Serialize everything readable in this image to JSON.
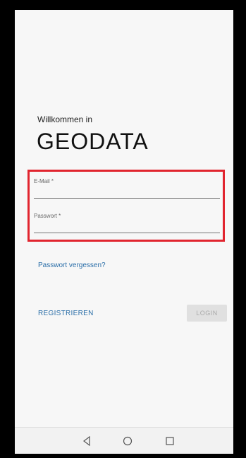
{
  "welcome": "Willkommen in",
  "app_title": "GEODATA",
  "form": {
    "email_label": "E-Mail *",
    "email_value": "",
    "password_label": "Passwort *",
    "password_value": ""
  },
  "links": {
    "forgot_password": "Passwort vergessen?",
    "register": "REGISTRIEREN"
  },
  "buttons": {
    "login": "LOGIN"
  },
  "navbar": {
    "icons": [
      "back-icon",
      "home-icon",
      "recent-apps-icon"
    ]
  },
  "colors": {
    "highlight": "#e1252f",
    "link": "#2a6ea8",
    "disabled_button": "#e0e0e0"
  }
}
